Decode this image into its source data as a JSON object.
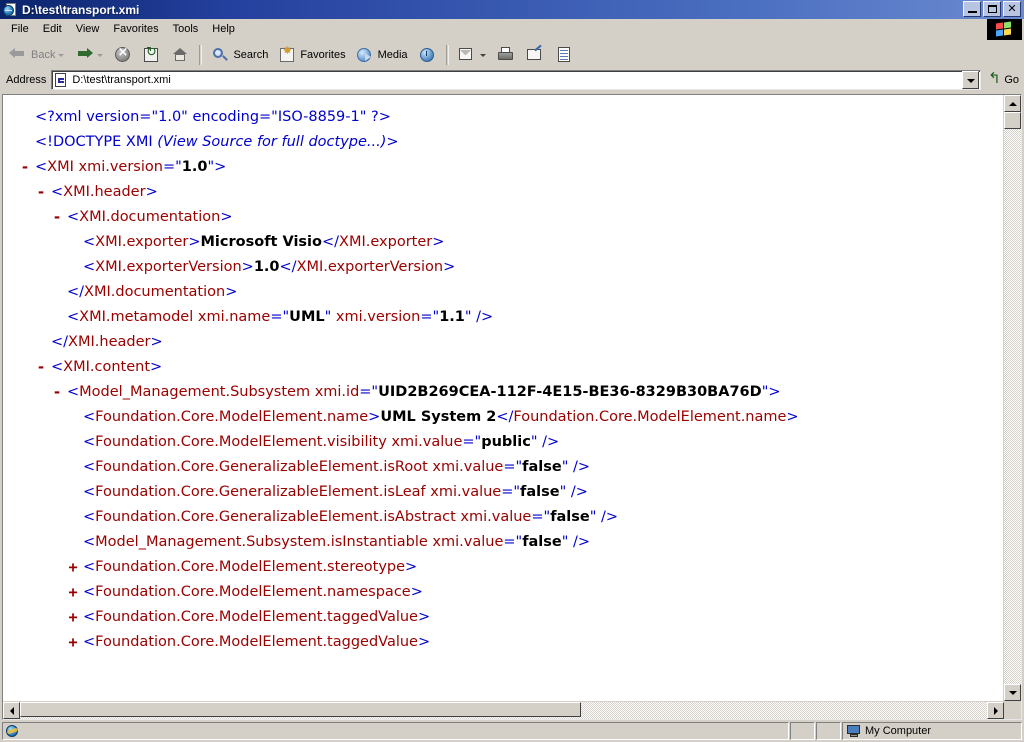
{
  "window": {
    "title": "D:\\test\\transport.xmi",
    "icon": "ie-document-icon",
    "controls": [
      {
        "name": "minimize-button",
        "label": "_"
      },
      {
        "name": "restore-button",
        "label": "❐"
      },
      {
        "name": "close-button",
        "label": "×"
      }
    ]
  },
  "menubar": {
    "items": [
      "File",
      "Edit",
      "View",
      "Favorites",
      "Tools",
      "Help"
    ],
    "brand_icon": "windows-flag-logo"
  },
  "toolbar": {
    "buttons": [
      {
        "name": "back-button",
        "label": "Back",
        "icon": "back-arrow-icon",
        "disabled": true,
        "dropdown": true
      },
      {
        "name": "forward-button",
        "label": "",
        "icon": "forward-arrow-icon",
        "disabled": false,
        "dropdown": true
      },
      {
        "name": "stop-button",
        "label": "",
        "icon": "stop-icon",
        "disabled": false,
        "dropdown": false
      },
      {
        "name": "refresh-button",
        "label": "",
        "icon": "refresh-icon",
        "disabled": false,
        "dropdown": false
      },
      {
        "name": "home-button",
        "label": "",
        "icon": "home-icon",
        "disabled": false,
        "dropdown": false
      },
      {
        "name": "search-button",
        "label": "Search",
        "icon": "search-icon",
        "disabled": false,
        "dropdown": false
      },
      {
        "name": "favorites-button",
        "label": "Favorites",
        "icon": "favorites-star-icon",
        "disabled": false,
        "dropdown": false
      },
      {
        "name": "media-button",
        "label": "Media",
        "icon": "media-icon",
        "disabled": false,
        "dropdown": false
      },
      {
        "name": "history-button",
        "label": "",
        "icon": "history-clock-icon",
        "disabled": false,
        "dropdown": false
      },
      {
        "name": "mail-button",
        "label": "",
        "icon": "mail-icon",
        "disabled": false,
        "dropdown": true
      },
      {
        "name": "print-button",
        "label": "",
        "icon": "printer-icon",
        "disabled": false,
        "dropdown": false
      },
      {
        "name": "edit-button",
        "label": "",
        "icon": "edit-page-icon",
        "disabled": false,
        "dropdown": false
      },
      {
        "name": "discuss-button",
        "label": "",
        "icon": "discuss-icon",
        "disabled": false,
        "dropdown": false
      }
    ]
  },
  "address": {
    "label": "Address",
    "value": "D:\\test\\transport.xmi",
    "placeholder": "",
    "doc_icon": "xml-document-icon",
    "dropdown_icon": "chevron-down-icon",
    "go_label": "Go",
    "go_icon": "go-arrow-icon"
  },
  "document": {
    "lines": [
      {
        "indent": 1,
        "twisty": "",
        "parts": [
          {
            "c": "pi",
            "t": "<?xml version=\"1.0\" encoding=\"ISO-8859-1\" ?>"
          }
        ]
      },
      {
        "indent": 1,
        "twisty": "",
        "parts": [
          {
            "c": "doct",
            "t": "<!DOCTYPE XMI "
          },
          {
            "c": "doct-i",
            "t": "(View Source for full doctype...)"
          },
          {
            "c": "doct",
            "t": ">"
          }
        ]
      },
      {
        "indent": 1,
        "twisty": "-",
        "parts": [
          {
            "c": "punct",
            "t": "<"
          },
          {
            "c": "tag",
            "t": "XMI"
          },
          {
            "c": "attr",
            "t": " xmi.version"
          },
          {
            "c": "punct",
            "t": "=\""
          },
          {
            "c": "aval",
            "t": "1.0"
          },
          {
            "c": "punct",
            "t": "\">"
          }
        ]
      },
      {
        "indent": 2,
        "twisty": "-",
        "parts": [
          {
            "c": "punct",
            "t": "<"
          },
          {
            "c": "tag",
            "t": "XMI.header"
          },
          {
            "c": "punct",
            "t": ">"
          }
        ]
      },
      {
        "indent": 3,
        "twisty": "-",
        "parts": [
          {
            "c": "punct",
            "t": "<"
          },
          {
            "c": "tag",
            "t": "XMI.documentation"
          },
          {
            "c": "punct",
            "t": ">"
          }
        ]
      },
      {
        "indent": 4,
        "twisty": "",
        "parts": [
          {
            "c": "punct",
            "t": "<"
          },
          {
            "c": "tag",
            "t": "XMI.exporter"
          },
          {
            "c": "punct",
            "t": ">"
          },
          {
            "c": "txt",
            "t": "Microsoft Visio"
          },
          {
            "c": "punct",
            "t": "</"
          },
          {
            "c": "tag",
            "t": "XMI.exporter"
          },
          {
            "c": "punct",
            "t": ">"
          }
        ]
      },
      {
        "indent": 4,
        "twisty": "",
        "parts": [
          {
            "c": "punct",
            "t": "<"
          },
          {
            "c": "tag",
            "t": "XMI.exporterVersion"
          },
          {
            "c": "punct",
            "t": ">"
          },
          {
            "c": "txt",
            "t": "1.0"
          },
          {
            "c": "punct",
            "t": "</"
          },
          {
            "c": "tag",
            "t": "XMI.exporterVersion"
          },
          {
            "c": "punct",
            "t": ">"
          }
        ]
      },
      {
        "indent": 3,
        "twisty": "",
        "parts": [
          {
            "c": "punct",
            "t": "</"
          },
          {
            "c": "tag",
            "t": "XMI.documentation"
          },
          {
            "c": "punct",
            "t": ">"
          }
        ]
      },
      {
        "indent": 3,
        "twisty": "",
        "parts": [
          {
            "c": "punct",
            "t": "<"
          },
          {
            "c": "tag",
            "t": "XMI.metamodel"
          },
          {
            "c": "attr",
            "t": " xmi.name"
          },
          {
            "c": "punct",
            "t": "=\""
          },
          {
            "c": "aval",
            "t": "UML"
          },
          {
            "c": "punct",
            "t": "\""
          },
          {
            "c": "attr",
            "t": " xmi.version"
          },
          {
            "c": "punct",
            "t": "=\""
          },
          {
            "c": "aval",
            "t": "1.1"
          },
          {
            "c": "punct",
            "t": "\" />"
          }
        ]
      },
      {
        "indent": 2,
        "twisty": "",
        "parts": [
          {
            "c": "punct",
            "t": "</"
          },
          {
            "c": "tag",
            "t": "XMI.header"
          },
          {
            "c": "punct",
            "t": ">"
          }
        ]
      },
      {
        "indent": 2,
        "twisty": "-",
        "parts": [
          {
            "c": "punct",
            "t": "<"
          },
          {
            "c": "tag",
            "t": "XMI.content"
          },
          {
            "c": "punct",
            "t": ">"
          }
        ]
      },
      {
        "indent": 3,
        "twisty": "-",
        "wrap": true,
        "parts": [
          {
            "c": "punct",
            "t": "<"
          },
          {
            "c": "tag",
            "t": "Model_Management.Subsystem"
          },
          {
            "c": "attr",
            "t": " xmi.id"
          },
          {
            "c": "punct",
            "t": "=\""
          },
          {
            "c": "aval",
            "t": "UID2B269CEA-112F-4E15-BE36-8329B30BA76D"
          },
          {
            "c": "punct",
            "t": "\">"
          }
        ]
      },
      {
        "indent": 4,
        "twisty": "",
        "wrap": true,
        "parts": [
          {
            "c": "punct",
            "t": "<"
          },
          {
            "c": "tag",
            "t": "Foundation.Core.ModelElement.name"
          },
          {
            "c": "punct",
            "t": ">"
          },
          {
            "c": "txt",
            "t": "UML System 2"
          },
          {
            "c": "punct",
            "t": "</"
          },
          {
            "c": "tag",
            "t": "Foundation.Core.ModelElement.name"
          },
          {
            "c": "punct",
            "t": ">"
          }
        ]
      },
      {
        "indent": 4,
        "twisty": "",
        "parts": [
          {
            "c": "punct",
            "t": "<"
          },
          {
            "c": "tag",
            "t": "Foundation.Core.ModelElement.visibility"
          },
          {
            "c": "attr",
            "t": " xmi.value"
          },
          {
            "c": "punct",
            "t": "=\""
          },
          {
            "c": "aval",
            "t": "public"
          },
          {
            "c": "punct",
            "t": "\" />"
          }
        ]
      },
      {
        "indent": 4,
        "twisty": "",
        "parts": [
          {
            "c": "punct",
            "t": "<"
          },
          {
            "c": "tag",
            "t": "Foundation.Core.GeneralizableElement.isRoot"
          },
          {
            "c": "attr",
            "t": " xmi.value"
          },
          {
            "c": "punct",
            "t": "=\""
          },
          {
            "c": "aval",
            "t": "false"
          },
          {
            "c": "punct",
            "t": "\" />"
          }
        ]
      },
      {
        "indent": 4,
        "twisty": "",
        "parts": [
          {
            "c": "punct",
            "t": "<"
          },
          {
            "c": "tag",
            "t": "Foundation.Core.GeneralizableElement.isLeaf"
          },
          {
            "c": "attr",
            "t": " xmi.value"
          },
          {
            "c": "punct",
            "t": "=\""
          },
          {
            "c": "aval",
            "t": "false"
          },
          {
            "c": "punct",
            "t": "\" />"
          }
        ]
      },
      {
        "indent": 4,
        "twisty": "",
        "parts": [
          {
            "c": "punct",
            "t": "<"
          },
          {
            "c": "tag",
            "t": "Foundation.Core.GeneralizableElement.isAbstract"
          },
          {
            "c": "attr",
            "t": " xmi.value"
          },
          {
            "c": "punct",
            "t": "=\""
          },
          {
            "c": "aval",
            "t": "false"
          },
          {
            "c": "punct",
            "t": "\" />"
          }
        ]
      },
      {
        "indent": 4,
        "twisty": "",
        "parts": [
          {
            "c": "punct",
            "t": "<"
          },
          {
            "c": "tag",
            "t": "Model_Management.Subsystem.isInstantiable"
          },
          {
            "c": "attr",
            "t": " xmi.value"
          },
          {
            "c": "punct",
            "t": "=\""
          },
          {
            "c": "aval",
            "t": "false"
          },
          {
            "c": "punct",
            "t": "\" />"
          }
        ]
      },
      {
        "indent": 4,
        "twisty": "+",
        "parts": [
          {
            "c": "punct",
            "t": "<"
          },
          {
            "c": "tag",
            "t": "Foundation.Core.ModelElement.stereotype"
          },
          {
            "c": "punct",
            "t": ">"
          }
        ]
      },
      {
        "indent": 4,
        "twisty": "+",
        "parts": [
          {
            "c": "punct",
            "t": "<"
          },
          {
            "c": "tag",
            "t": "Foundation.Core.ModelElement.namespace"
          },
          {
            "c": "punct",
            "t": ">"
          }
        ]
      },
      {
        "indent": 4,
        "twisty": "+",
        "parts": [
          {
            "c": "punct",
            "t": "<"
          },
          {
            "c": "tag",
            "t": "Foundation.Core.ModelElement.taggedValue"
          },
          {
            "c": "punct",
            "t": ">"
          }
        ]
      },
      {
        "indent": 4,
        "twisty": "+",
        "parts": [
          {
            "c": "punct",
            "t": "<"
          },
          {
            "c": "tag",
            "t": "Foundation.Core.ModelElement.taggedValue"
          },
          {
            "c": "punct",
            "t": ">"
          }
        ]
      }
    ]
  },
  "statusbar": {
    "message": "",
    "zone": "My Computer",
    "zone_icon": "my-computer-icon",
    "left_icon": "ie-globe-icon"
  },
  "colors": {
    "titlebar_start": "#0a246a",
    "titlebar_end": "#6b8ad0",
    "chrome": "#d4d0c8",
    "xml_punct": "#0000cd",
    "xml_tag": "#990000",
    "xml_value": "#000000"
  }
}
